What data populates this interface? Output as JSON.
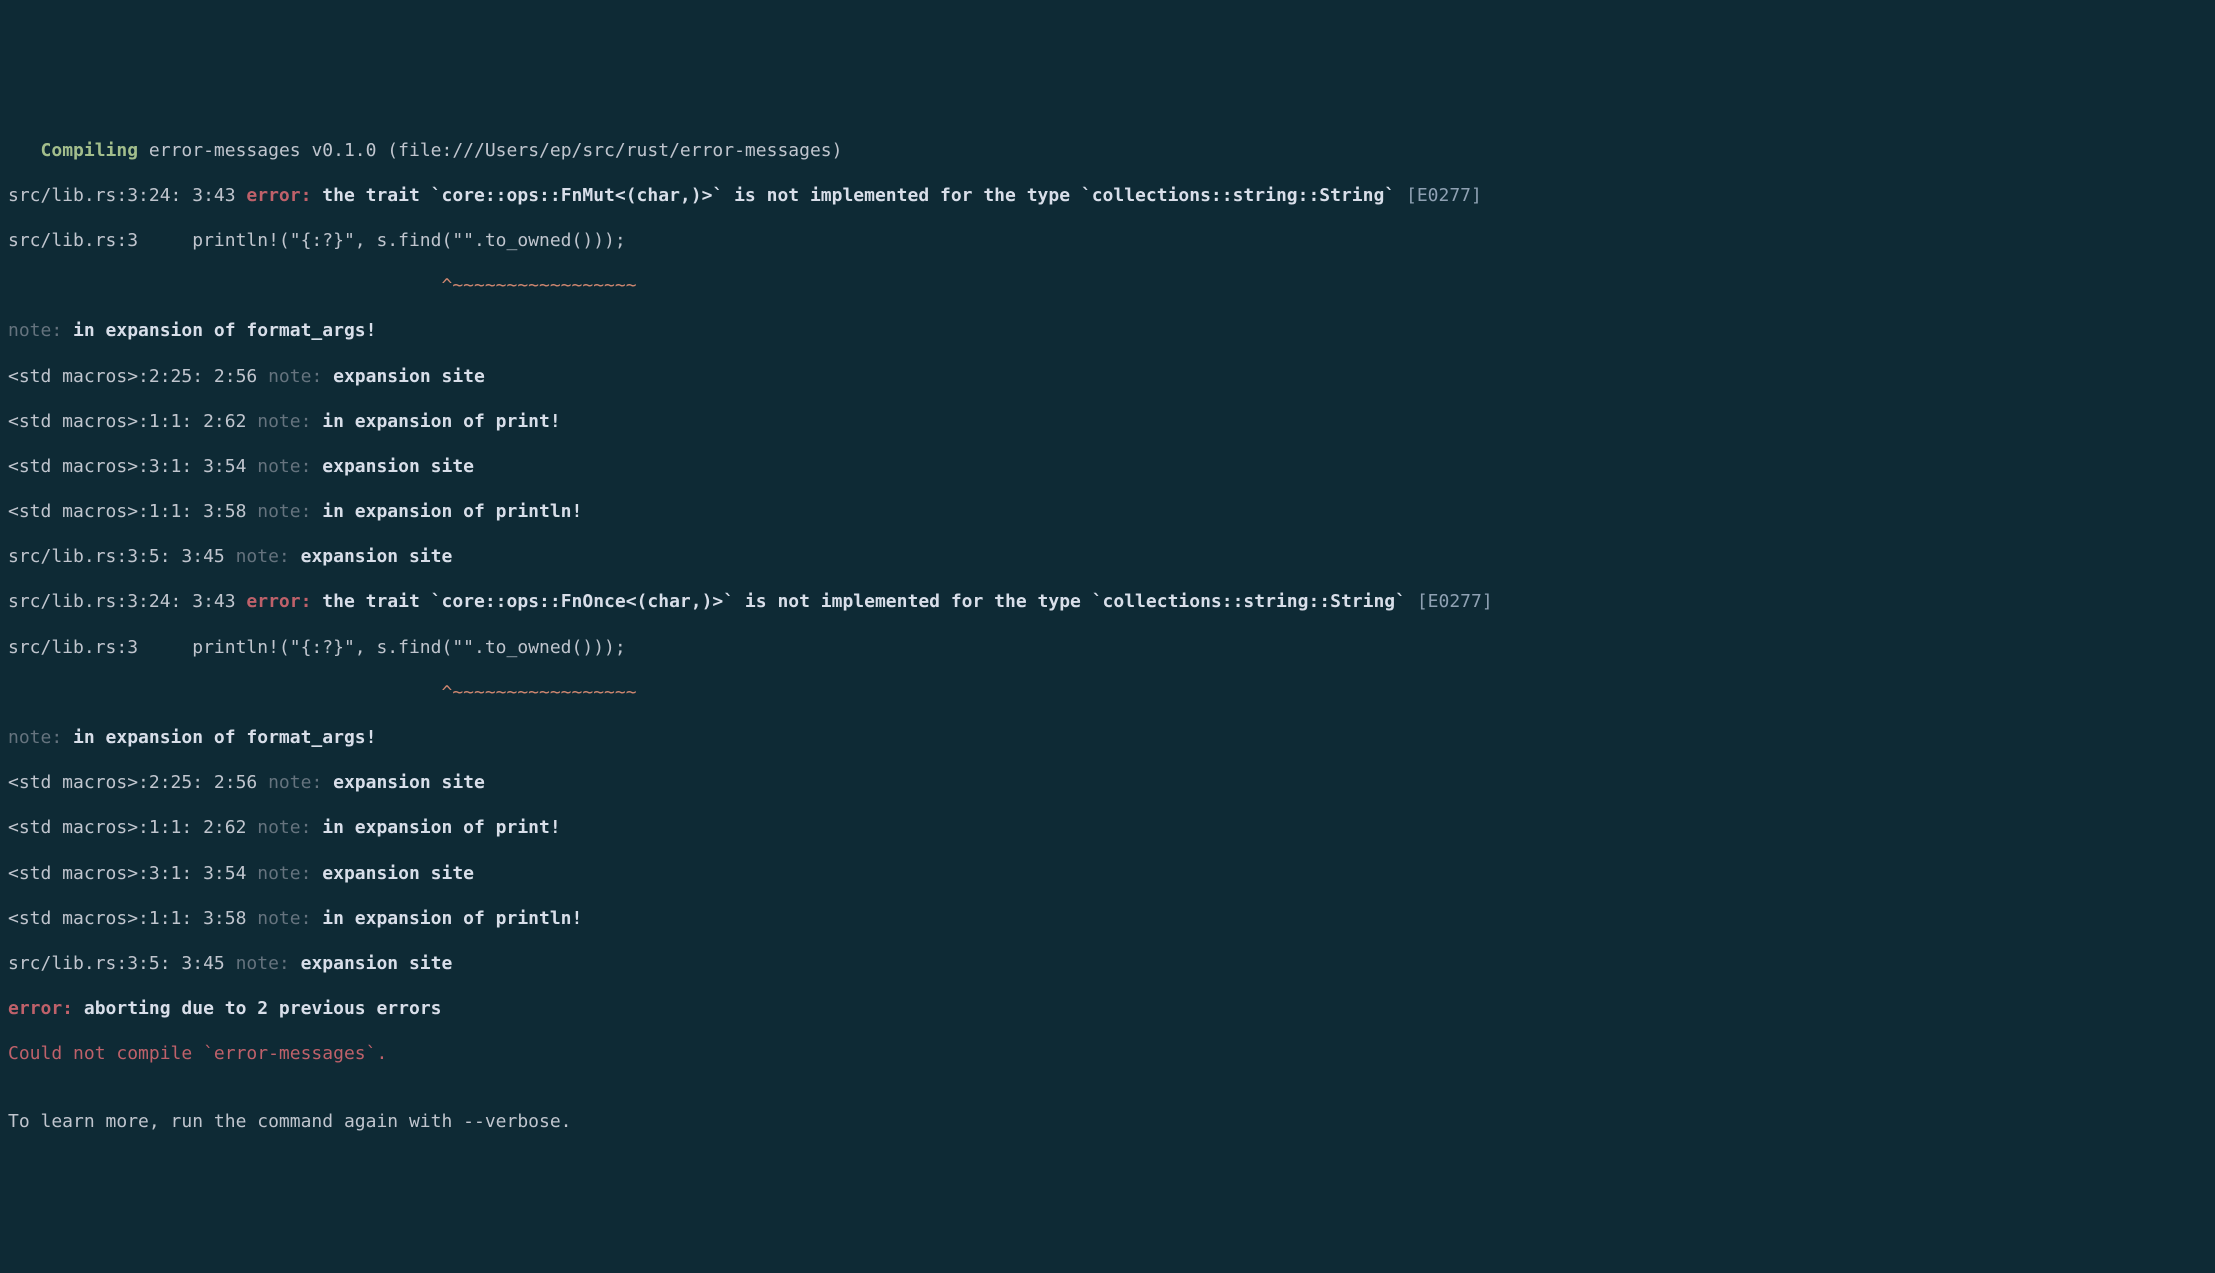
{
  "colors": {
    "bg": "#0e2a35",
    "fg": "#c0c5ce",
    "dim": "#65737e",
    "bold": "#d8dee9",
    "green": "#a3be8c",
    "red": "#bf616a",
    "orange": "#d08770",
    "blue": "#8fa1b3"
  },
  "compile_header": {
    "indent": "   ",
    "label": "Compiling",
    "tail": " error-messages v0.1.0 (file:///Users/ep/src/rust/error-messages)"
  },
  "error1": {
    "loc": "src/lib.rs:3:24: 3:43 ",
    "tag": "error:",
    "msg": " the trait `core::ops::FnMut<(char,)>` is not implemented for the type `collections::string::String` ",
    "code": "[E0277]"
  },
  "source_line": "src/lib.rs:3     println!(\"{:?}\", s.find(\"\".to_owned()));",
  "caret_line": "                                        ^~~~~~~~~~~~~~~~~~",
  "note_format_args": {
    "prefix": "note:",
    "msg": " in expansion of format_args!"
  },
  "macro_lines": [
    {
      "loc": "<std macros>:2:25: 2:56 ",
      "tag": "note:",
      "msg": " expansion site"
    },
    {
      "loc": "<std macros>:1:1: 2:62 ",
      "tag": "note:",
      "msg": " in expansion of print!"
    },
    {
      "loc": "<std macros>:3:1: 3:54 ",
      "tag": "note:",
      "msg": " expansion site"
    },
    {
      "loc": "<std macros>:1:1: 3:58 ",
      "tag": "note:",
      "msg": " in expansion of println!"
    },
    {
      "loc": "src/lib.rs:3:5: 3:45 ",
      "tag": "note:",
      "msg": " expansion site"
    }
  ],
  "error2": {
    "loc": "src/lib.rs:3:24: 3:43 ",
    "tag": "error:",
    "msg": " the trait `core::ops::FnOnce<(char,)>` is not implemented for the type `collections::string::String` ",
    "code": "[E0277]"
  },
  "abort": {
    "tag": "error:",
    "msg": " aborting due to 2 previous errors"
  },
  "could_not_compile": "Could not compile `error-messages`.",
  "blank": "",
  "learn_more": "To learn more, run the command again with --verbose."
}
